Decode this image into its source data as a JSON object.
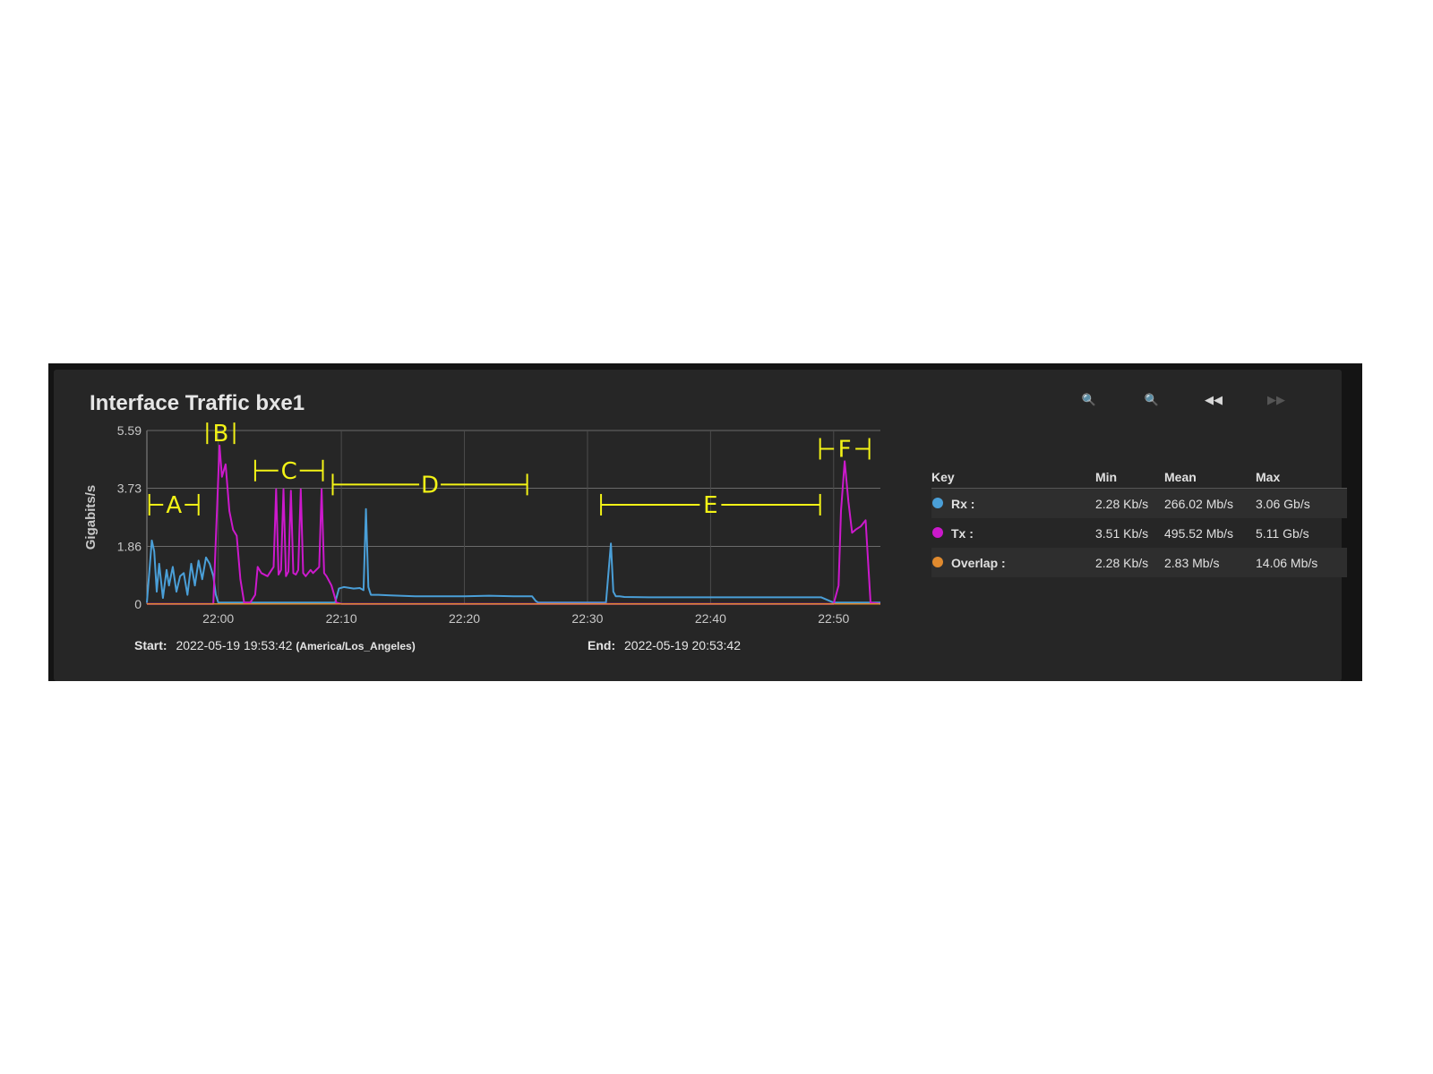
{
  "panel": {
    "title": "Interface Traffic bxe1",
    "toolbar": [
      {
        "name": "zoom-in-icon",
        "glyph": "🔍",
        "enabled": false
      },
      {
        "name": "zoom-out-icon",
        "glyph": "🔍",
        "enabled": true
      },
      {
        "name": "back-icon",
        "glyph": "◀◀",
        "enabled": true
      },
      {
        "name": "forward-icon",
        "glyph": "▶▶",
        "enabled": false
      }
    ],
    "start_label": "Start:",
    "start_value": "2022-05-19 19:53:42",
    "start_tz": "(America/Los_Angeles)",
    "end_label": "End:",
    "end_value": "2022-05-19 20:53:42"
  },
  "legend": {
    "headers": {
      "key": "Key",
      "min": "Min",
      "mean": "Mean",
      "max": "Max"
    },
    "rows": [
      {
        "name": "Rx :",
        "color": "#4a9fd8",
        "min": "2.28 Kb/s",
        "mean": "266.02 Mb/s",
        "max": "3.06 Gb/s"
      },
      {
        "name": "Tx :",
        "color": "#cc19cc",
        "min": "3.51 Kb/s",
        "mean": "495.52 Mb/s",
        "max": "5.11 Gb/s"
      },
      {
        "name": "Overlap :",
        "color": "#e08a2e",
        "min": "2.28 Kb/s",
        "mean": "2.83 Mb/s",
        "max": "14.06 Mb/s"
      }
    ]
  },
  "chart_data": {
    "type": "line",
    "ylabel": "Gigabits/s",
    "ylim": [
      0,
      5.59
    ],
    "y_ticks": [
      "0",
      "1.86",
      "3.73",
      "5.59"
    ],
    "y_tick_values": [
      0,
      1.86,
      3.73,
      5.59
    ],
    "x_ticks": [
      "22:00",
      "22:10",
      "22:20",
      "22:30",
      "22:40",
      "22:50"
    ],
    "x_tick_values": [
      0,
      10,
      20,
      30,
      40,
      50
    ],
    "xlim": [
      -5.8,
      53.8
    ],
    "grid": true,
    "colors": {
      "Rx": "#4a9fd8",
      "Tx": "#cc19cc",
      "Overlap": "#e08a2e",
      "annotation": "#f3f316"
    },
    "series": [
      {
        "name": "Rx",
        "x": [
          -5.8,
          -5.4,
          -5.2,
          -5.0,
          -4.8,
          -4.5,
          -4.2,
          -4.0,
          -3.7,
          -3.4,
          -3.1,
          -2.8,
          -2.5,
          -2.2,
          -1.9,
          -1.6,
          -1.3,
          -1.0,
          -0.7,
          -0.4,
          -0.2,
          0.0,
          0.2,
          0.5,
          1.0,
          2.0,
          5.0,
          8.0,
          9.5,
          9.8,
          10.2,
          11.0,
          11.5,
          11.8,
          12.0,
          12.2,
          12.4,
          12.7,
          13.0,
          14.0,
          16.0,
          18.0,
          20.0,
          22.0,
          24.0,
          25.5,
          25.8,
          26.0,
          28.0,
          31.5,
          31.9,
          32.1,
          32.3,
          32.6,
          33.0,
          35.0,
          40.0,
          45.0,
          49.0,
          50.0,
          50.3,
          50.6,
          51.0,
          53.8
        ],
        "values": [
          0.05,
          2.05,
          1.7,
          0.4,
          1.3,
          0.2,
          1.1,
          0.6,
          1.2,
          0.4,
          0.9,
          1.0,
          0.3,
          1.3,
          0.6,
          1.4,
          0.8,
          1.5,
          1.3,
          0.9,
          0.3,
          0.05,
          0.05,
          0.05,
          0.05,
          0.05,
          0.05,
          0.05,
          0.05,
          0.5,
          0.55,
          0.5,
          0.52,
          0.45,
          3.06,
          0.55,
          0.3,
          0.3,
          0.3,
          0.28,
          0.25,
          0.25,
          0.25,
          0.27,
          0.25,
          0.25,
          0.1,
          0.05,
          0.05,
          0.05,
          1.95,
          0.4,
          0.25,
          0.25,
          0.23,
          0.22,
          0.22,
          0.22,
          0.22,
          0.05,
          0.05,
          0.05,
          0.05,
          0.05
        ]
      },
      {
        "name": "Tx",
        "x": [
          -5.8,
          -0.4,
          -0.2,
          0.1,
          0.3,
          0.6,
          0.9,
          1.2,
          1.5,
          1.8,
          2.1,
          2.6,
          3.0,
          3.2,
          3.5,
          4.0,
          4.5,
          4.7,
          4.9,
          5.1,
          5.3,
          5.5,
          5.7,
          5.9,
          6.1,
          6.3,
          6.5,
          6.7,
          6.9,
          7.1,
          7.3,
          7.5,
          7.7,
          8.2,
          8.4,
          8.6,
          8.8,
          9.2,
          9.6,
          10.0,
          20.0,
          30.0,
          40.0,
          50.0,
          50.4,
          50.6,
          50.9,
          51.2,
          51.5,
          51.8,
          52.2,
          52.6,
          53.0,
          53.8
        ],
        "values": [
          0.01,
          0.01,
          2.1,
          5.11,
          4.1,
          4.5,
          3.0,
          2.4,
          2.2,
          0.8,
          0.05,
          0.05,
          0.3,
          1.2,
          1.0,
          0.9,
          1.2,
          3.7,
          0.95,
          1.1,
          3.7,
          0.9,
          1.05,
          3.65,
          1.0,
          0.95,
          1.1,
          3.7,
          1.0,
          0.9,
          1.0,
          1.1,
          1.0,
          1.2,
          3.7,
          1.0,
          0.9,
          0.6,
          0.05,
          0.01,
          0.01,
          0.01,
          0.01,
          0.01,
          0.6,
          3.0,
          4.6,
          3.3,
          2.3,
          2.4,
          2.5,
          2.7,
          0.05,
          0.01
        ]
      },
      {
        "name": "Overlap",
        "x": [
          -5.8,
          53.8
        ],
        "values": [
          0.01,
          0.01
        ]
      }
    ],
    "annotations": [
      {
        "label": "A",
        "from": -5.6,
        "to": -1.6,
        "y": 3.2
      },
      {
        "label": "B",
        "from": -0.9,
        "to": 1.3,
        "y": 5.5
      },
      {
        "label": "C",
        "from": 3.0,
        "to": 8.5,
        "y": 4.3
      },
      {
        "label": "D",
        "from": 9.3,
        "to": 25.1,
        "y": 3.85
      },
      {
        "label": "E",
        "from": 31.1,
        "to": 48.9,
        "y": 3.2
      },
      {
        "label": "F",
        "from": 48.9,
        "to": 52.9,
        "y": 5.0
      }
    ]
  }
}
